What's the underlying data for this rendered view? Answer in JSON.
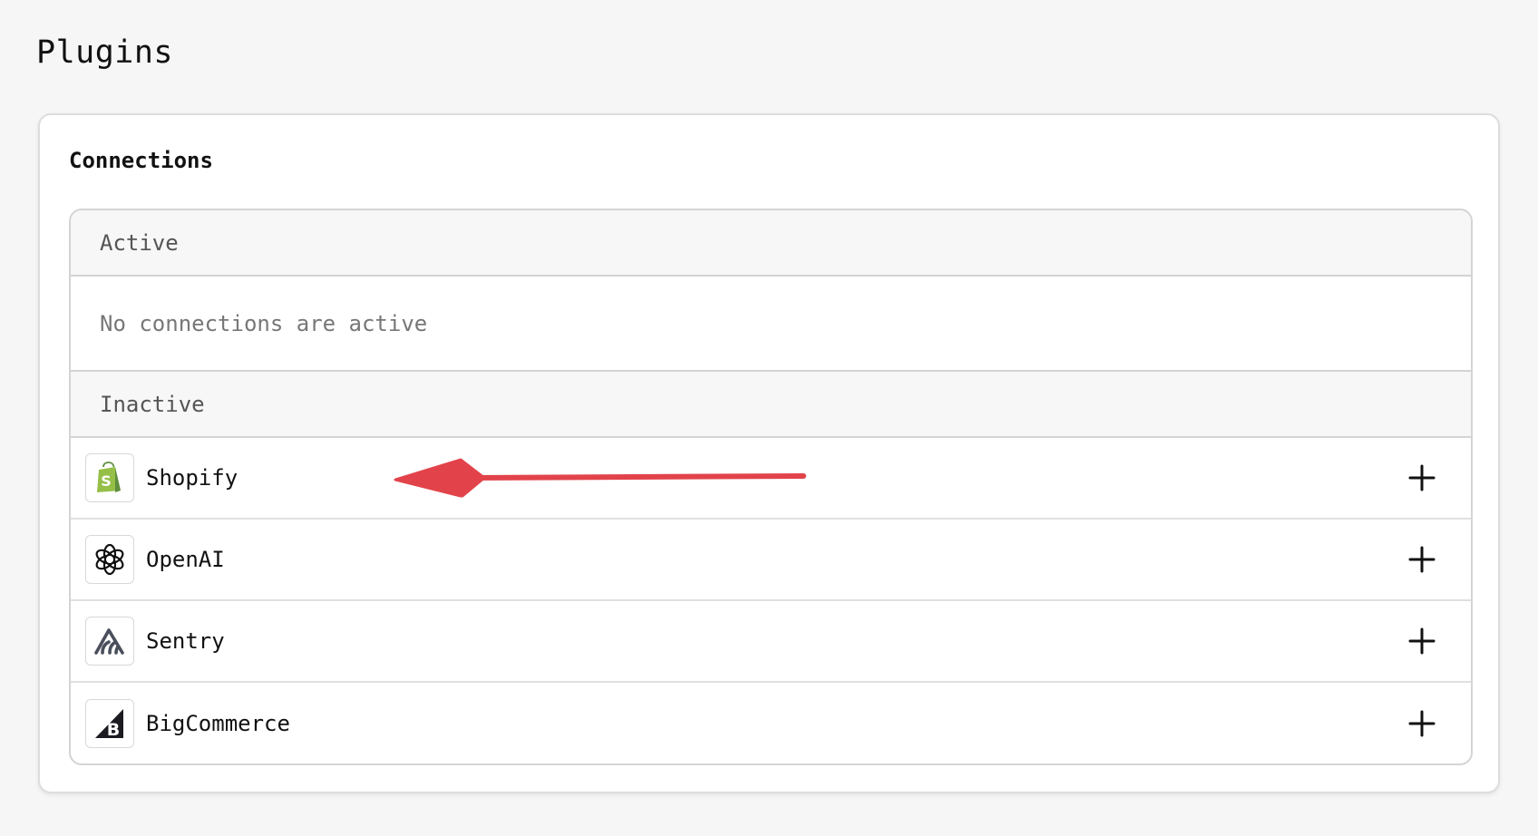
{
  "page": {
    "title": "Plugins"
  },
  "connections": {
    "title": "Connections",
    "active": {
      "label": "Active",
      "empty_text": "No connections are active"
    },
    "inactive": {
      "label": "Inactive",
      "items": [
        {
          "name": "Shopify",
          "icon": "shopify-icon",
          "action_icon": "plus-icon"
        },
        {
          "name": "OpenAI",
          "icon": "openai-icon",
          "action_icon": "plus-icon"
        },
        {
          "name": "Sentry",
          "icon": "sentry-icon",
          "action_icon": "plus-icon"
        },
        {
          "name": "BigCommerce",
          "icon": "bigcommerce-icon",
          "action_icon": "plus-icon"
        }
      ]
    }
  },
  "colors": {
    "background": "#f6f6f6",
    "card": "#ffffff",
    "border": "#d4d4d4",
    "section_header": "#f7f7f7",
    "annotation_arrow": "#e2434b",
    "shopify_green": "#95bf47",
    "sentry": "#362d59",
    "bigcommerce": "#121118"
  }
}
